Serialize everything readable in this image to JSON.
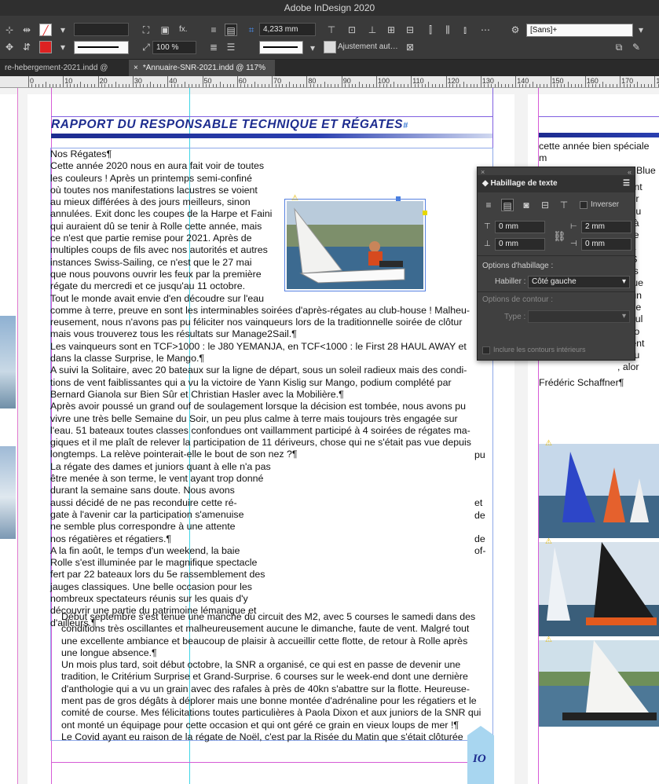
{
  "app": {
    "title": "Adobe InDesign 2020"
  },
  "control_bar": {
    "stroke_weight": "",
    "dimension_value": "4,233 mm",
    "scale_value": "100 %",
    "autofit_label": "Ajustement aut…",
    "object_style": "[Sans]+",
    "fx_label": "fx."
  },
  "tabs": [
    {
      "label": "re-hebergement-2021.indd @ 83%"
    },
    {
      "label": "*Annuaire-SNR-2021.indd @ 117%",
      "close": "×"
    }
  ],
  "ruler": {
    "labels": [
      "0",
      "10",
      "20",
      "30",
      "40",
      "50",
      "60",
      "70",
      "80",
      "90",
      "100",
      "110",
      "120",
      "130",
      "140",
      "150",
      "160",
      "170",
      "180"
    ]
  },
  "document": {
    "heading": "RAPPORT DU RESPONSABLE TECHNIQUE ET RÉGATES",
    "heading_mark": "#",
    "body_lines": [
      "Nos Régates¶",
      "Cette année 2020 nous en aura fait voir de toutes",
      "les couleurs ! Après un printemps semi-confiné",
      "où toutes nos manifestations lacustres se voient",
      "au mieux différées à des jours meilleurs, sinon",
      "annulées. Exit donc les coupes de la Harpe et Faini",
      "qui auraient dû se tenir à Rolle cette année, mais",
      "ce n'est que partie remise pour 2021. Après de",
      "multiples coups de fils avec nos autorités et autres",
      "instances Swiss-Sailing, ce n'est que le 27 mai",
      "que nous pouvons ouvrir les feux par la première",
      "régate du mercredi et ce jusqu'au 11 octobre.",
      "Tout le monde avait envie d'en découdre sur l'eau",
      "comme à terre, preuve en sont les interminables soirées d'après-régates au club-house ! Malheu-",
      "reusement, nous n'avons pas pu féliciter nos vainqueurs lors de la traditionnelle soirée de clôtur",
      "mais vous trouverez tous les résultats sur Manage2Sail.¶",
      "Les vainqueurs sont en TCF>1000 : le J80 YEMANJA, en TCF<1000 : le First 28 HAUL AWAY et",
      "dans la classe Surprise, le Mango.¶",
      "A suivi la Solitaire, avec 20 bateaux sur la ligne de départ, sous un soleil radieux mais des condi-",
      "tions de vent faiblissantes qui a vu la victoire de Yann Kislig sur Mango, podium complété par",
      "Bernard Gianola sur Bien Sûr et Christian Hasler avec la Mobilière.¶",
      "Après avoir poussé un grand ouf de soulagement lorsque la décision est tombée, nous avons pu",
      "vivre une très belle Semaine du Soir, un peu plus calme à terre mais toujours très engagée sur",
      "l'eau. 51 bateaux toutes classes confondues ont vaillamment participé à 4 soirées de régates ma-",
      "giques et il me plaît de relever la participation de 11 dériveurs, chose qui ne s'était pas vue depuis",
      "longtemps. La relève pointerait-elle le bout de son nez ?¶",
      "La régate des dames et juniors quant à elle n'a pas",
      "être menée à son terme, le vent ayant trop donné",
      "durant la semaine sans doute. Nous avons",
      "aussi décidé de ne pas reconduire cette ré-",
      "gate  à  l'avenir  car  la  participation  s'amenuise",
      "ne   semble   plus   correspondre   à   une   attente",
      "nos régatières et régatiers.¶",
      "A  la  fin  août,  le  temps  d'un  weekend,  la  baie",
      "Rolle  s'est  illuminée  par  le  magnifique  spectacle",
      "fert par 22 bateaux lors du 5e rassemblement des",
      "jauges classiques. Une belle occasion pour les",
      "nombreux spectateurs réunis sur les quais d'y",
      "découvrir une partie du patrimoine lémanique et",
      "d'ailleurs.¶"
    ],
    "right_fragments": [
      "pu",
      "et",
      "de",
      "de",
      "of-"
    ],
    "indented_paragraphs": [
      "Début septembre s'est tenue une manche du circuit des M2, avec 5 courses le samedi dans des",
      "conditions très oscillantes et malheureusement aucune le dimanche, faute de vent. Malgré tout",
      "une excellente ambiance et beaucoup de plaisir à accueillir cette flotte, de retour à Rolle après",
      "une longue absence.¶",
      "Un mois plus tard, soit début octobre, la SNR a organisé, ce qui est en passe de devenir une",
      "tradition, le Critérium Surprise et Grand-Surprise. 6 courses sur le week-end dont une dernière",
      "d'anthologie qui a vu un grain avec des rafales à près de 40kn s'abattre sur la flotte. Heureuse-",
      "ment pas de gros dégâts à déplorer mais une bonne montée d'adrénaline pour les régatiers et le",
      "comité de course. Mes félicitations toutes particulières à Paola Dixon et aux juniors de la SNR qui",
      "ont monté un équipage pour cette occasion et qui ont géré ce grain en vieux loups de mer !¶",
      "Le Covid ayant eu raison de la régate de Noël, c'est par la Risée du Matin que s'était clôturée"
    ],
    "page_number": "IO"
  },
  "right_page": {
    "lines": [
      "cette année bien spéciale m",
      "régates. Le X99 Deep Blue",
      "Frédéric Schaffner¶"
    ],
    "fragments": [
      "rment",
      "l, per",
      "s pou",
      "ont à",
      "votre",
      "rci à",
      "au S",
      "niors",
      "lelque",
      "nir un",
      "nce e",
      "s soul",
      "ur no",
      "ement",
      "ur qu",
      ", alor"
    ]
  },
  "wrap_panel": {
    "title": "Habillage de texte",
    "invert_label": "Inverser",
    "top_offset": "0 mm",
    "bottom_offset": "0 mm",
    "left_offset": "2 mm",
    "right_offset": "0 mm",
    "options_title": "Options d'habillage :",
    "wrap_label": "Habiller :",
    "wrap_value": "Côté gauche",
    "contour_title": "Options de contour :",
    "type_label": "Type :",
    "type_value": "",
    "include_inner": "Inclure les contours intérieurs"
  },
  "colors": {
    "accent": "#1d2c8f",
    "guide_magenta": "#e040e0",
    "guide_cyan": "#40d0e0",
    "frame_blue": "#4a7fe0"
  }
}
